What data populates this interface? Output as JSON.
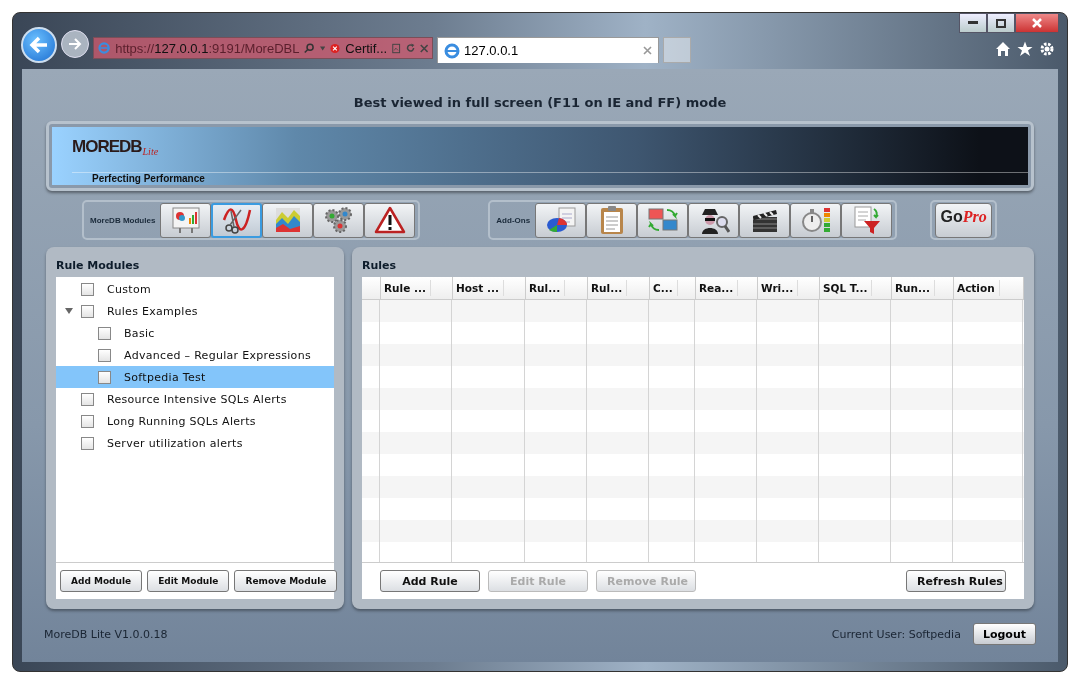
{
  "browser": {
    "address_host_prefix": "https://",
    "address_host": "127.0.0.1",
    "address_rest": ":9191/MoreDBL",
    "certificate": "Certif...",
    "tab": {
      "title": "127.0.0.1"
    }
  },
  "notice": "Best viewed in full screen (F11 on IE and FF) mode",
  "logo": {
    "name": "MOREDB",
    "edition": "Lite",
    "tagline": "Perfecting Performance"
  },
  "modules_toolbar": {
    "label": "MoreDB Modules",
    "buttons": [
      {
        "kind": "report",
        "selected": false
      },
      {
        "kind": "scissors",
        "selected": true
      },
      {
        "kind": "area",
        "selected": false
      },
      {
        "kind": "gears",
        "selected": false
      },
      {
        "kind": "warning",
        "selected": false
      }
    ]
  },
  "addons_toolbar": {
    "label": "Add-Ons",
    "buttons": [
      {
        "kind": "pie"
      },
      {
        "kind": "clipboard"
      },
      {
        "kind": "monitors"
      },
      {
        "kind": "spy"
      },
      {
        "kind": "clapper"
      },
      {
        "kind": "stopwatch"
      },
      {
        "kind": "funnel"
      }
    ]
  },
  "gopro": {
    "go": "Go",
    "pro": "Pro"
  },
  "rule_modules": {
    "title": "Rule Modules",
    "tree": [
      {
        "label": "Custom",
        "checked": false,
        "selected": false
      },
      {
        "label": "Rules Examples",
        "checked": false,
        "selected": false,
        "expanded": true,
        "children": [
          {
            "label": "Basic",
            "checked": false,
            "selected": false
          },
          {
            "label": "Advanced – Regular Expressions",
            "checked": false,
            "selected": false
          },
          {
            "label": "Softpedia Test",
            "checked": false,
            "selected": true
          }
        ]
      },
      {
        "label": "Resource Intensive SQLs Alerts",
        "checked": false,
        "selected": false
      },
      {
        "label": "Long Running SQLs Alerts",
        "checked": false,
        "selected": false
      },
      {
        "label": "Server utilization alerts",
        "checked": false,
        "selected": false
      }
    ],
    "buttons": [
      {
        "label": "Add Module",
        "disabled": false
      },
      {
        "label": "Edit Module",
        "disabled": false
      },
      {
        "label": "Remove Module",
        "disabled": false
      }
    ]
  },
  "rules": {
    "title": "Rules",
    "columns": [
      "Rule ...",
      "Host ...",
      "Rul...",
      "Rul...",
      "C...",
      "Rea...",
      "Wri...",
      "SQL T...",
      "Run...",
      "Action"
    ],
    "buttons": [
      {
        "label": "Add Rule",
        "disabled": false
      },
      {
        "label": "Edit Rule",
        "disabled": true
      },
      {
        "label": "Remove Rule",
        "disabled": true
      }
    ],
    "refresh": {
      "label": "Refresh Rules",
      "disabled": false
    }
  },
  "footer": {
    "version": "MoreDB Lite V1.0.0.18",
    "user": "Current User: Softpedia",
    "logout": "Logout"
  }
}
